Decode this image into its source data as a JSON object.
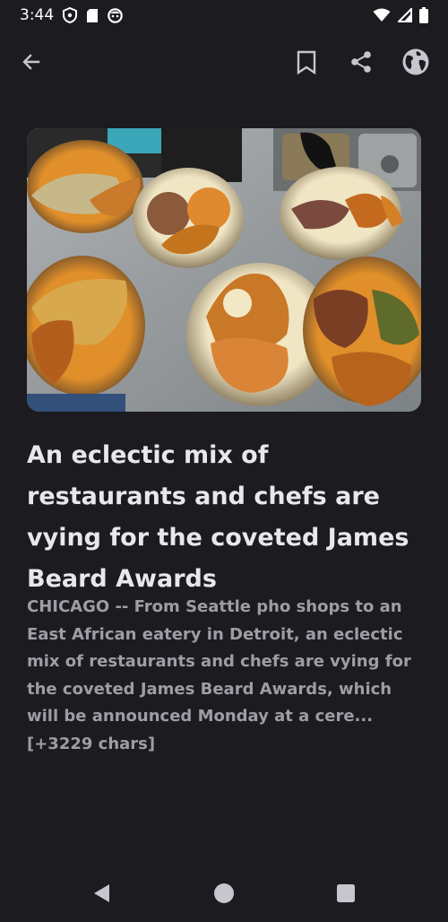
{
  "status_bar": {
    "time": "3:44",
    "icons": [
      "shield-icon",
      "sd-card-icon",
      "face-icon",
      "wifi-icon",
      "signal-icon",
      "battery-icon"
    ]
  },
  "toolbar": {
    "back_icon": "arrow-back-icon",
    "bookmark_icon": "bookmark-icon",
    "share_icon": "share-icon",
    "web_icon": "globe-icon"
  },
  "article": {
    "title": "An eclectic mix of restaurants and chefs are vying for the coveted James Beard Awards",
    "summary": "CHICAGO -- From Seattle pho shops to an East African eatery in Detroit, an eclectic mix of restaurants and chefs are vying for the coveted James Beard Awards, which will be announced Monday at a cere... [+3229 chars]"
  },
  "nav_bar": {
    "back_icon": "triangle-back-icon",
    "home_icon": "circle-home-icon",
    "recents_icon": "square-recents-icon"
  },
  "colors": {
    "background": "#1c1b1f",
    "title": "#e9e6ec",
    "summary": "#a09ca6",
    "icon": "#c9c5cf"
  }
}
